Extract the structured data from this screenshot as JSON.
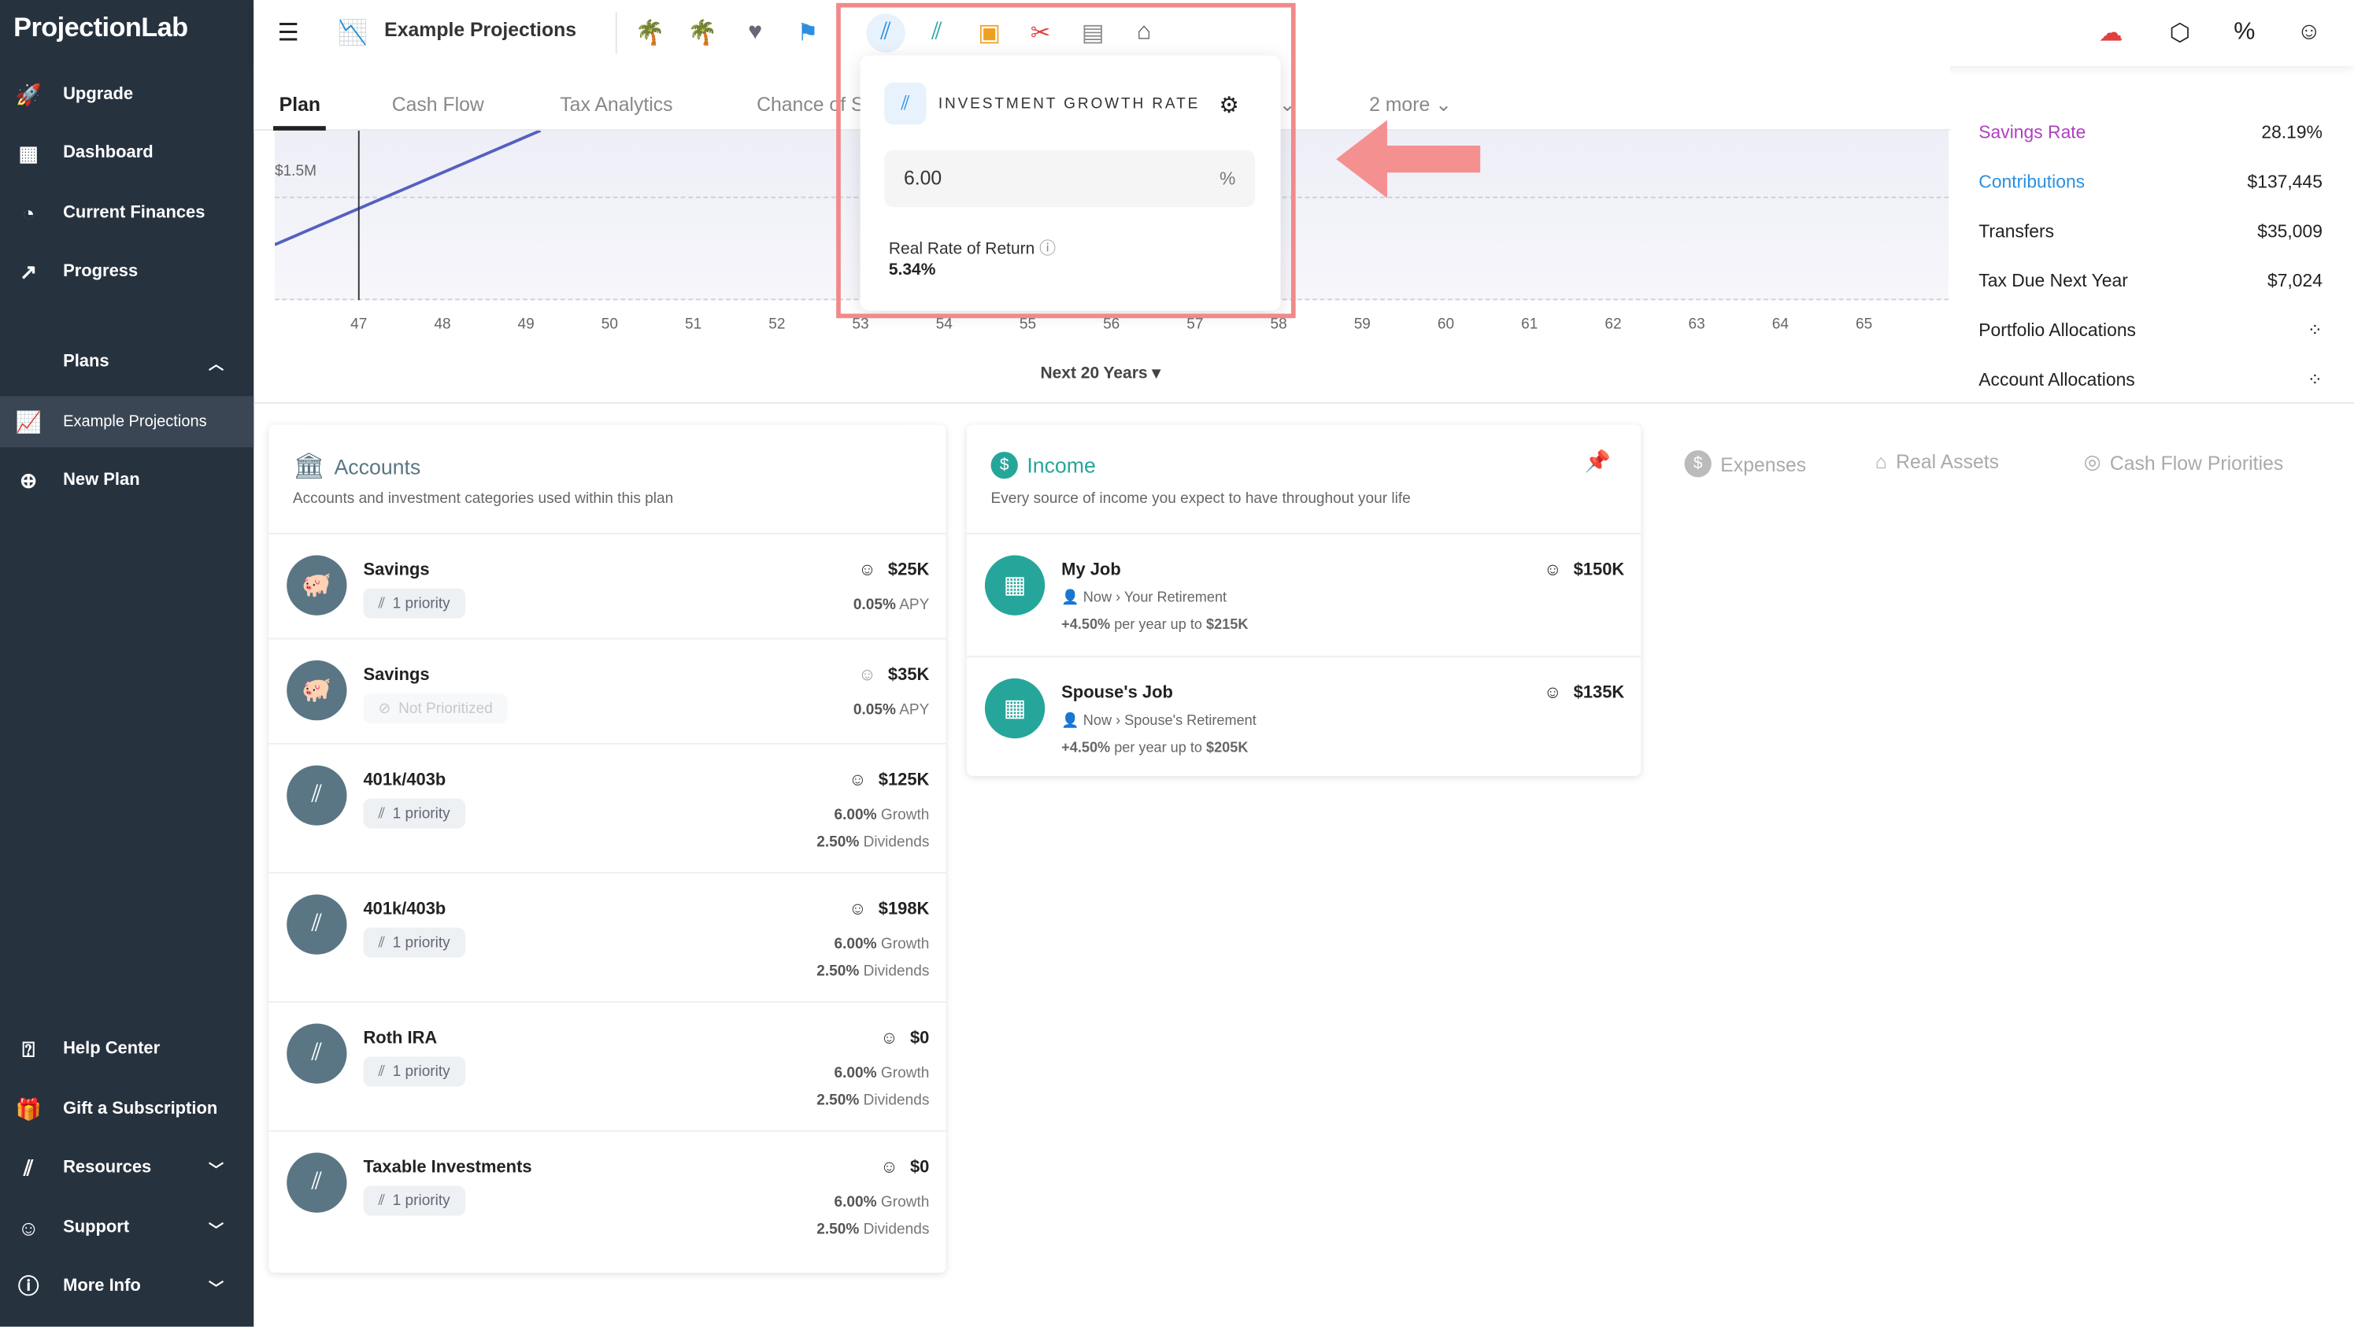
{
  "app": {
    "logo": "ProjectionLab",
    "plan_title": "Example Projections"
  },
  "sidebar": {
    "items": [
      {
        "label": "Upgrade",
        "icon": "rocket-icon"
      },
      {
        "label": "Dashboard",
        "icon": "dashboard-icon"
      },
      {
        "label": "Current Finances",
        "icon": "finances-icon"
      },
      {
        "label": "Progress",
        "icon": "trend-icon"
      }
    ],
    "plans_label": "Plans",
    "plans": [
      {
        "label": "Example Projections",
        "active": true
      },
      {
        "label": "New Plan"
      }
    ],
    "bottom": [
      {
        "label": "Help Center"
      },
      {
        "label": "Gift a Subscription"
      },
      {
        "label": "Resources"
      },
      {
        "label": "Support"
      },
      {
        "label": "More Info"
      }
    ]
  },
  "tabs": {
    "items": [
      "Plan",
      "Cash Flow",
      "Tax Analytics",
      "Chance of S"
    ],
    "active": "Plan",
    "more": "2 more"
  },
  "chart": {
    "y_label": "$1.5M",
    "x_ticks": [
      "47",
      "48",
      "49",
      "50",
      "51",
      "52",
      "53",
      "54",
      "55",
      "56",
      "57",
      "58",
      "59",
      "60",
      "61",
      "62",
      "63",
      "64",
      "65"
    ],
    "current_age": "47",
    "range_label": "Next 20 Years",
    "line_color": "#5560c0"
  },
  "popup": {
    "title": "INVESTMENT GROWTH RATE",
    "value": "6.00",
    "unit": "%",
    "real_label": "Real Rate of Return",
    "real_value": "5.34%"
  },
  "summary": [
    {
      "label": "Savings Rate",
      "value": "28.19%",
      "color": "#b040c0"
    },
    {
      "label": "Contributions",
      "value": "$137,445",
      "color": "#2a8fe0"
    },
    {
      "label": "Transfers",
      "value": "$35,009"
    },
    {
      "label": "Tax Due Next Year",
      "value": "$7,024"
    },
    {
      "label": "Portfolio Allocations",
      "value": ""
    },
    {
      "label": "Account Allocations",
      "value": ""
    }
  ],
  "accounts": {
    "title": "Accounts",
    "desc": "Accounts and investment categories used within this plan",
    "items": [
      {
        "name": "Savings",
        "badge": "1 priority",
        "value": "$25K",
        "sub1": "0.05%",
        "sub1l": "APY",
        "type": "savings"
      },
      {
        "name": "Savings",
        "badge": "Not Prioritized",
        "value": "$35K",
        "sub1": "0.05%",
        "sub1l": "APY",
        "type": "savings",
        "off": true
      },
      {
        "name": "401k/403b",
        "badge": "1 priority",
        "value": "$125K",
        "sub1": "6.00%",
        "sub1l": "Growth",
        "sub2": "2.50%",
        "sub2l": "Dividends"
      },
      {
        "name": "401k/403b",
        "badge": "1 priority",
        "value": "$198K",
        "sub1": "6.00%",
        "sub1l": "Growth",
        "sub2": "2.50%",
        "sub2l": "Dividends"
      },
      {
        "name": "Roth IRA",
        "badge": "1 priority",
        "value": "$0",
        "sub1": "6.00%",
        "sub1l": "Growth",
        "sub2": "2.50%",
        "sub2l": "Dividends"
      },
      {
        "name": "Taxable Investments",
        "badge": "1 priority",
        "value": "$0",
        "sub1": "6.00%",
        "sub1l": "Growth",
        "sub2": "2.50%",
        "sub2l": "Dividends"
      }
    ]
  },
  "income": {
    "title": "Income",
    "desc": "Every source of income you expect to have throughout your life",
    "items": [
      {
        "name": "My Job",
        "value": "$150K",
        "from": "Now",
        "to": "Your Retirement",
        "growth": "+4.50%",
        "growth_text": "per year up to",
        "cap": "$215K"
      },
      {
        "name": "Spouse's Job",
        "value": "$135K",
        "from": "Now",
        "to": "Spouse's Retirement",
        "growth": "+4.50%",
        "growth_text": "per year up to",
        "cap": "$205K"
      }
    ]
  },
  "other_tabs": [
    "Expenses",
    "Real Assets",
    "Cash Flow Priorities"
  ],
  "colors": {
    "sidebar": "#27323f",
    "teal": "#26a69a",
    "slate": "#5a7684",
    "highlight": "#f08a8a"
  }
}
